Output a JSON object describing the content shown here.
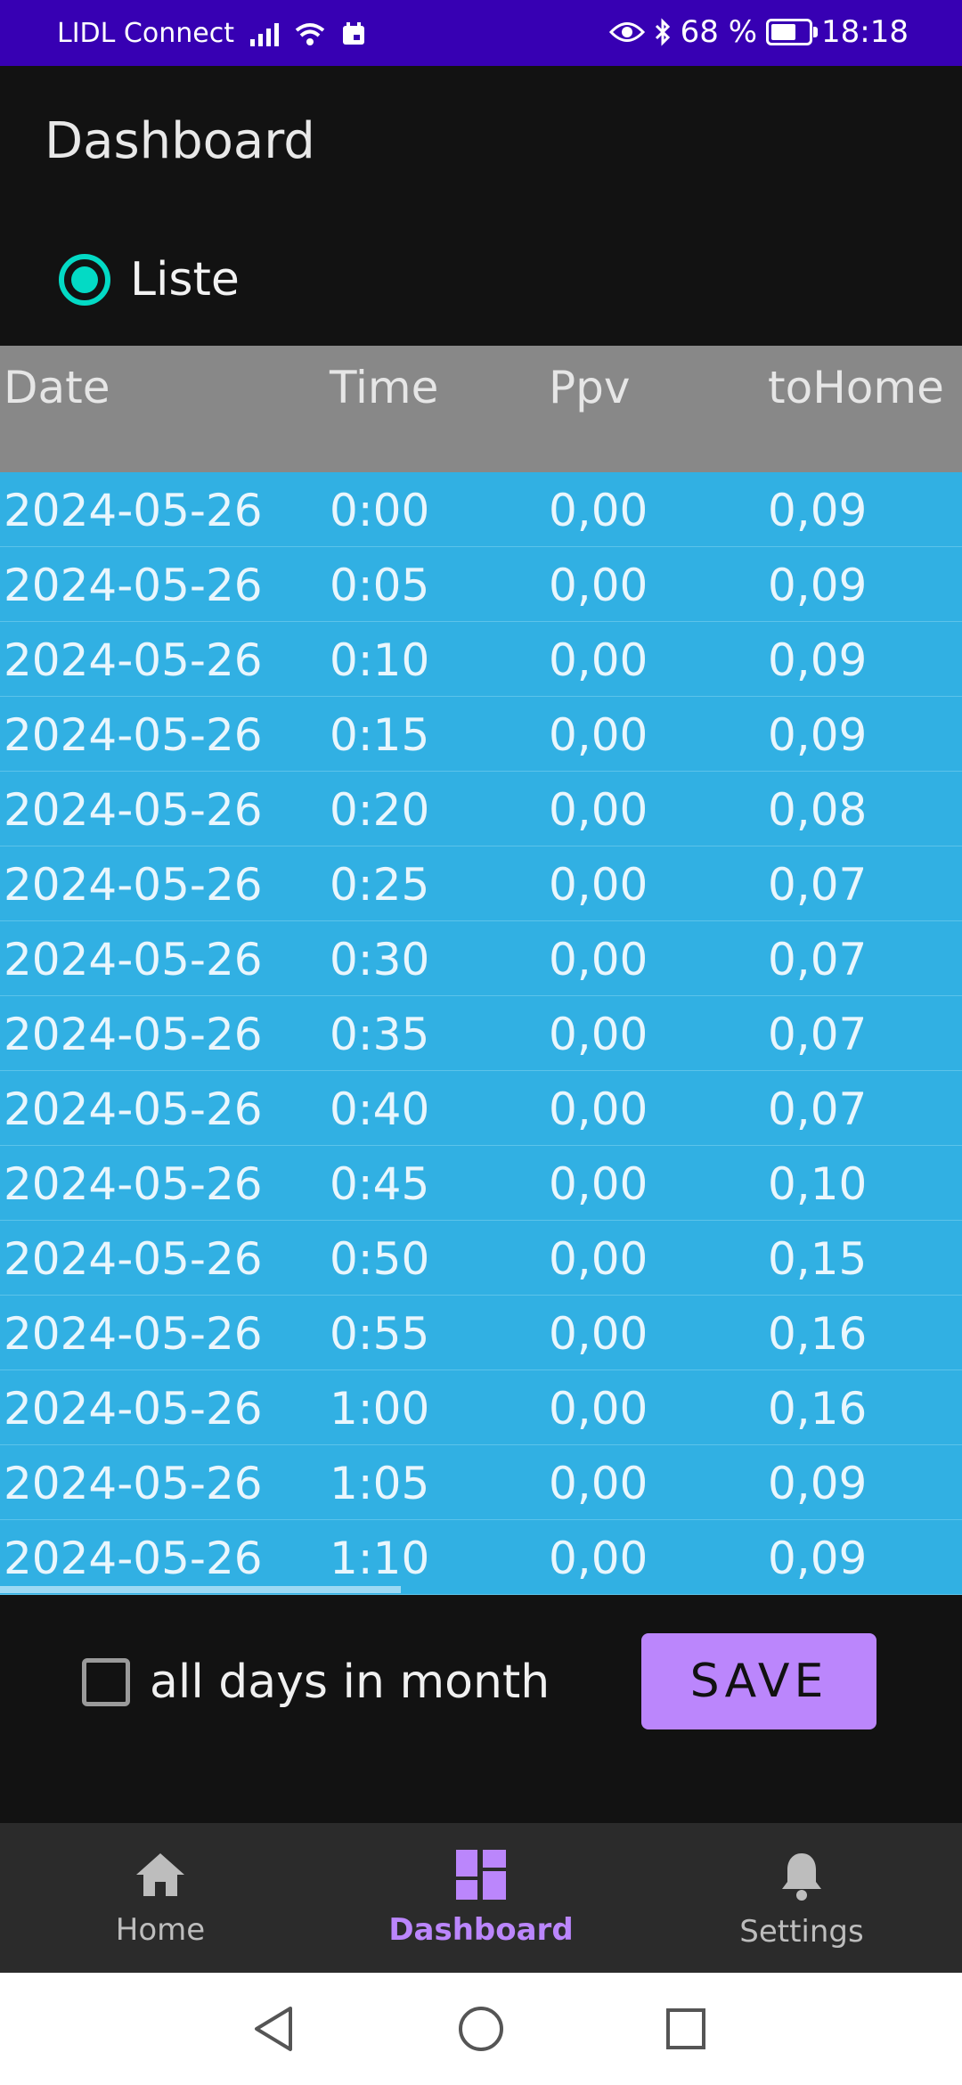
{
  "status_bar": {
    "carrier": "LIDL Connect",
    "battery": "68 %",
    "battery_level": 0.68,
    "time": "18:18",
    "icons": [
      "signal-icon",
      "wifi-icon",
      "calendar-icon",
      "eye-icon",
      "bluetooth-icon",
      "battery-icon"
    ]
  },
  "app": {
    "title": "Dashboard"
  },
  "view_mode": {
    "label": "Liste",
    "selected": true
  },
  "table": {
    "headers": {
      "date": "Date",
      "time": "Time",
      "ppv": "Ppv",
      "tohome": "toHome"
    },
    "rows": [
      {
        "date": "2024-05-26",
        "time": "0:00",
        "ppv": "0,00",
        "tohome": "0,09"
      },
      {
        "date": "2024-05-26",
        "time": "0:05",
        "ppv": "0,00",
        "tohome": "0,09"
      },
      {
        "date": "2024-05-26",
        "time": "0:10",
        "ppv": "0,00",
        "tohome": "0,09"
      },
      {
        "date": "2024-05-26",
        "time": "0:15",
        "ppv": "0,00",
        "tohome": "0,09"
      },
      {
        "date": "2024-05-26",
        "time": "0:20",
        "ppv": "0,00",
        "tohome": "0,08"
      },
      {
        "date": "2024-05-26",
        "time": "0:25",
        "ppv": "0,00",
        "tohome": "0,07"
      },
      {
        "date": "2024-05-26",
        "time": "0:30",
        "ppv": "0,00",
        "tohome": "0,07"
      },
      {
        "date": "2024-05-26",
        "time": "0:35",
        "ppv": "0,00",
        "tohome": "0,07"
      },
      {
        "date": "2024-05-26",
        "time": "0:40",
        "ppv": "0,00",
        "tohome": "0,07"
      },
      {
        "date": "2024-05-26",
        "time": "0:45",
        "ppv": "0,00",
        "tohome": "0,10"
      },
      {
        "date": "2024-05-26",
        "time": "0:50",
        "ppv": "0,00",
        "tohome": "0,15"
      },
      {
        "date": "2024-05-26",
        "time": "0:55",
        "ppv": "0,00",
        "tohome": "0,16"
      },
      {
        "date": "2024-05-26",
        "time": "1:00",
        "ppv": "0,00",
        "tohome": "0,16"
      },
      {
        "date": "2024-05-26",
        "time": "1:05",
        "ppv": "0,00",
        "tohome": "0,09"
      },
      {
        "date": "2024-05-26",
        "time": "1:10",
        "ppv": "0,00",
        "tohome": "0,09"
      }
    ]
  },
  "controls": {
    "all_days_label": "all days in month",
    "all_days_checked": false,
    "save_label": "SAVE"
  },
  "bottom_nav": {
    "items": [
      {
        "label": "Home",
        "icon": "home-icon",
        "active": false
      },
      {
        "label": "Dashboard",
        "icon": "dashboard-icon",
        "active": true
      },
      {
        "label": "Settings",
        "icon": "bell-icon",
        "active": false
      }
    ]
  },
  "system_nav": {
    "icons": [
      "back-icon",
      "home-circle-icon",
      "recents-icon"
    ]
  },
  "colors": {
    "status_bar": "#3700B3",
    "accent": "#BB86FC",
    "radio": "#03DAC5",
    "table_body": "#31B0E3",
    "table_header": "#888888"
  }
}
